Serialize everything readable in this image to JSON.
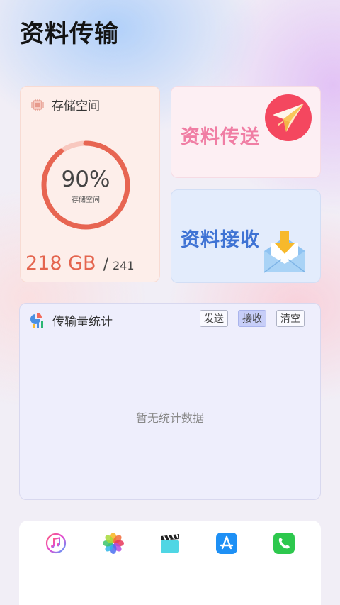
{
  "page": {
    "title": "资料传输"
  },
  "storage": {
    "label": "存储空间",
    "percent_text": "90%",
    "percent_value": 0.9,
    "sub_label": "存储空间",
    "used": "218 GB",
    "slash": "/",
    "total": "241",
    "ring_color": "#e76552",
    "ring_track_color": "#f8c8bf"
  },
  "send": {
    "label": "资料传送",
    "accent": "#f07ea4",
    "icon": "paper-plane-icon"
  },
  "receive": {
    "label": "资料接收",
    "accent": "#3f73d4",
    "icon": "inbox-envelope-icon"
  },
  "stats": {
    "label": "传输量统计",
    "tabs": [
      {
        "label": "发送",
        "active": false
      },
      {
        "label": "接收",
        "active": true
      },
      {
        "label": "清空",
        "active": false
      }
    ],
    "empty_text": "暂无统计数据"
  },
  "dock": {
    "apps": [
      {
        "name": "music-icon"
      },
      {
        "name": "photos-icon"
      },
      {
        "name": "video-icon"
      },
      {
        "name": "app-store-icon"
      },
      {
        "name": "phone-icon"
      }
    ]
  }
}
